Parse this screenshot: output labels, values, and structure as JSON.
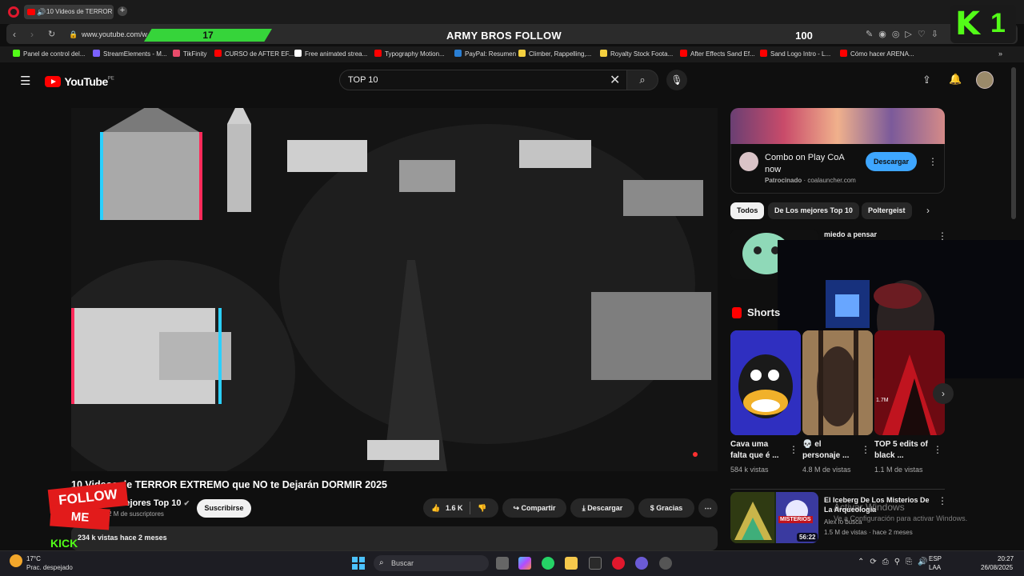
{
  "browser": {
    "tab_title": "10 Videos de TERROR",
    "new_tab_icon": "+",
    "url": "www.youtube.com/w",
    "bookmarks": [
      {
        "label": "Panel de control del...",
        "color": "#53fc18"
      },
      {
        "label": "StreamElements - M...",
        "color": "#7b61ff"
      },
      {
        "label": "TikFinity",
        "color": "#e84b6a"
      },
      {
        "label": "CURSO de AFTER EF...",
        "color": "#ff0000"
      },
      {
        "label": "Free animated strea...",
        "color": "#ffffff"
      },
      {
        "label": "Typography Motion...",
        "color": "#ff0000"
      },
      {
        "label": "PayPal: Resumen",
        "color": "#2a7fd4"
      },
      {
        "label": "Climber, Rappelling,...",
        "color": "#f4d03f"
      },
      {
        "label": "Royalty Stock Foota...",
        "color": "#f4d03f"
      },
      {
        "label": "After Effects Sand Ef...",
        "color": "#ff0000"
      },
      {
        "label": "Sand Logo Intro - L...",
        "color": "#ff0000"
      },
      {
        "label": "Cómo hacer ARENA...",
        "color": "#ff0000"
      }
    ]
  },
  "stream_overlay": {
    "counter_left": "17",
    "banner": "ARMY BROS FOLLOW",
    "counter_right": "100",
    "kick_logo_k": "K",
    "kick_logo_1": "1",
    "follow_line1": "FOLLOW",
    "follow_line2": "ME",
    "kick_text": "KICK"
  },
  "youtube": {
    "logo": "YouTube",
    "logo_region": "PE",
    "search_value": "TOP 10",
    "video": {
      "title": "10 Videos de TERROR EXTREMO que NO te Dejarán DORMIR 2025",
      "channel": "Los mejores Top 10",
      "subscribers": "5.42 M de suscriptores",
      "subscribe_label": "Suscribirse",
      "likes": "1.6 K",
      "share_label": "Compartir",
      "download_label": "Descargar",
      "thanks_label": "Gracias",
      "views_and_date": "234 k vistas  hace 2 meses"
    },
    "ad": {
      "title": "Combo on Play CoA now",
      "sponsored": "Patrocinado",
      "domain": "coalauncher.com",
      "button": "Descargar"
    },
    "chips": [
      "Todos",
      "De Los mejores Top 10",
      "Poltergeist"
    ],
    "rec1_title": "miedo a pensar",
    "shorts_heading": "Shorts",
    "shorts": [
      {
        "title": "Cava uma falta que é ...",
        "views": "584 k vistas",
        "badge": ""
      },
      {
        "title": "💀 el personaje ...",
        "views": "4.8 M de vistas",
        "badge": ""
      },
      {
        "title": "TOP 5 edits of black ...",
        "views": "1.1 M de vistas",
        "badge": "1.7M"
      }
    ],
    "rec2": {
      "title": "El Iceberg De Los Misterios De La Arqueología",
      "channel": "Alex lo busca",
      "meta": "1.5 M de vistas · hace 2 meses",
      "duration": "56:22",
      "thumb_word": "MISTERIOS"
    },
    "windows_watermark_1": "Activar Windows",
    "windows_watermark_2": "Ve a Configuración para activar Windows."
  },
  "taskbar": {
    "temperature": "17°C",
    "weather": "Prac. despejado",
    "search_placeholder": "Buscar",
    "lang_top": "ESP",
    "lang_bottom": "LAA",
    "time": "20:27",
    "date": "26/08/2025"
  }
}
